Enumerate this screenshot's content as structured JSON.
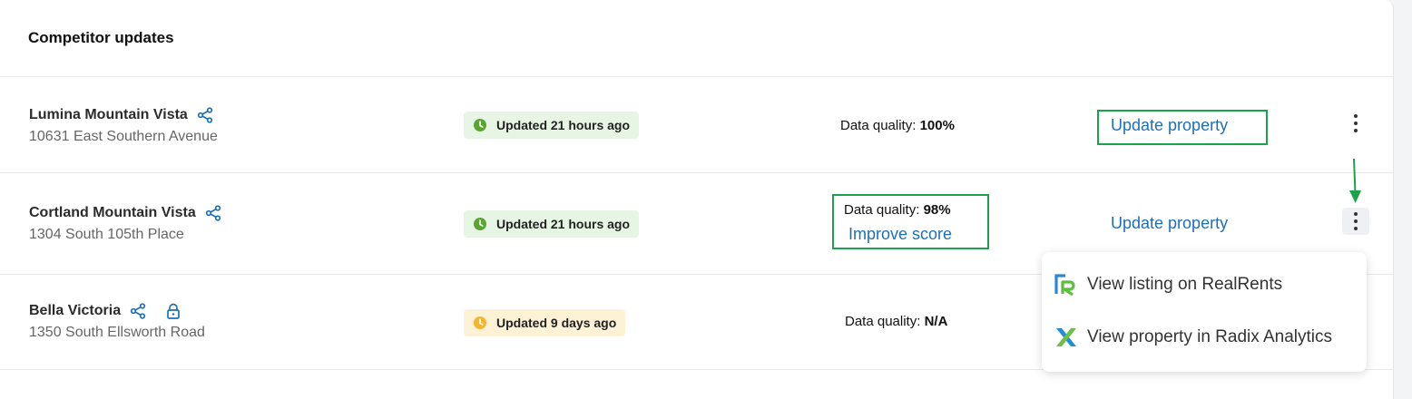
{
  "card": {
    "title": "Competitor updates"
  },
  "rows": [
    {
      "name": "Lumina Mountain Vista",
      "address": "10631 East Southern Avenue",
      "status": "Updated 21 hours ago",
      "dq_label": "Data quality:",
      "dq_value": "100%",
      "action": "Update property"
    },
    {
      "name": "Cortland Mountain Vista",
      "address": "1304 South 105th Place",
      "status": "Updated 21 hours ago",
      "dq_label": "Data quality:",
      "dq_value": "98%",
      "improve": "Improve score",
      "action": "Update property"
    },
    {
      "name": "Bella Victoria",
      "address": "1350 South Ellsworth Road",
      "status": "Updated 9 days ago",
      "dq_label": "Data quality:",
      "dq_value": "N/A"
    }
  ],
  "menu": {
    "items": [
      {
        "label": "View listing on RealRents",
        "icon": "realrents-logo-icon"
      },
      {
        "label": "View property in Radix Analytics",
        "icon": "radix-logo-icon"
      }
    ]
  },
  "colors": {
    "link": "#1d6fb8",
    "annotation": "#1aa34a",
    "status_recent": "#e7f6e4",
    "status_stale": "#fdf1d6"
  }
}
